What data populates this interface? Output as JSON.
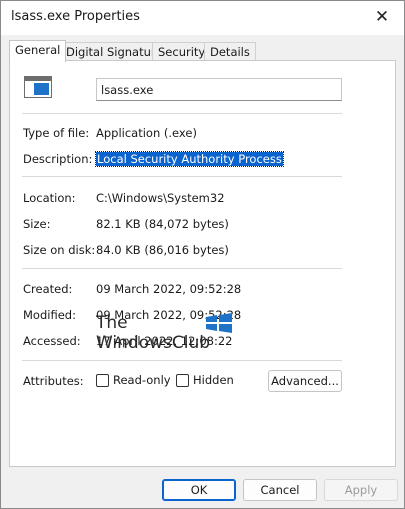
{
  "window": {
    "title": "lsass.exe Properties",
    "close_glyph": "✕"
  },
  "tabs": [
    {
      "label": "General"
    },
    {
      "label": "Digital Signatures"
    },
    {
      "label": "Security"
    },
    {
      "label": "Details"
    }
  ],
  "general": {
    "file_name": "lsass.exe",
    "fields": [
      {
        "label": "Type of file:",
        "value": "Application (.exe)"
      },
      {
        "label": "Description:",
        "value": "Local Security Authority Process"
      },
      {
        "label": "Location:",
        "value": "C:\\Windows\\System32"
      },
      {
        "label": "Size:",
        "value": "82.1 KB (84,072 bytes)"
      },
      {
        "label": "Size on disk:",
        "value": "84.0 KB (86,016 bytes)"
      },
      {
        "label": "Created:",
        "value": "09 March 2022, 09:52:28"
      },
      {
        "label": "Modified:",
        "value": "09 March 2022, 09:52:28"
      },
      {
        "label": "Accessed:",
        "value": "17 April 2022, 12:08:22"
      }
    ],
    "attributes": {
      "label": "Attributes:",
      "readonly_label": "Read-only",
      "hidden_label": "Hidden",
      "advanced_label": "Advanced..."
    }
  },
  "watermark": {
    "line1": "The",
    "line2": "WindowsClub"
  },
  "buttons": {
    "ok": "OK",
    "cancel": "Cancel",
    "apply": "Apply"
  }
}
